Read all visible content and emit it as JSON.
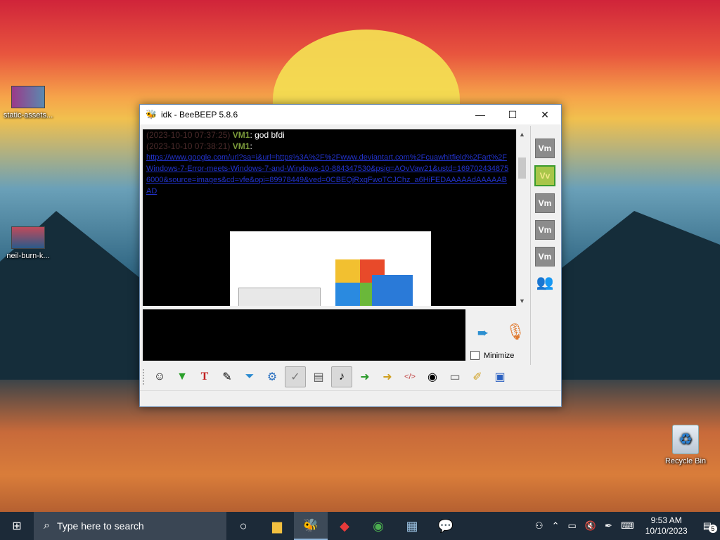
{
  "desktop": {
    "icons": [
      {
        "label": "static-assets..."
      },
      {
        "label": "neil-burn-k..."
      },
      {
        "label": "Recycle Bin"
      }
    ]
  },
  "window": {
    "title": "idk - BeeBEEP 5.8.6",
    "minimize_glyph": "—",
    "maximize_glyph": "☐",
    "close_glyph": "✕"
  },
  "chat": {
    "messages": [
      {
        "timestamp": "(2023-10-10 07:37:25)",
        "sender": "VM1",
        "text": "god bfdi"
      },
      {
        "timestamp": "(2023-10-10 07:38:21)",
        "sender": "VM1",
        "text": "https://www.google.com/url?sa=i&url=https%3A%2F%2Fwww.deviantart.com%2Fcuawhitfield%2Fart%2FWindows-7-Error-meets-Windows-7-and-Windows-10-884347530&psig=AOvVaw21&ustd=1697024348756000&source=images&cd=vfe&opi=89978449&ved=0CBEQjRxqFwoTCJChz_a6HiFEDAAAAAdAAAAABAD"
      }
    ]
  },
  "users": [
    {
      "label": "Vm",
      "active": false
    },
    {
      "label": "Vv",
      "active": true
    },
    {
      "label": "Vm",
      "active": false
    },
    {
      "label": "Vm",
      "active": false
    },
    {
      "label": "Vm",
      "active": false
    }
  ],
  "input": {
    "minimize_label": "Minimize"
  },
  "toolbar": {
    "buttons": [
      "smiley-icon",
      "save-chat-icon",
      "font-icon",
      "color-icon",
      "filter-icon",
      "settings-icon",
      "select-icon",
      "dictionary-icon",
      "sound-icon",
      "send-file-icon",
      "send-folder-icon",
      "html-icon",
      "screenshot-icon",
      "clear-icon",
      "edit-icon",
      "save-icon"
    ]
  },
  "taskbar": {
    "search_placeholder": "Type here to search",
    "time": "9:53 AM",
    "date": "10/10/2023",
    "notification_count": "5"
  }
}
